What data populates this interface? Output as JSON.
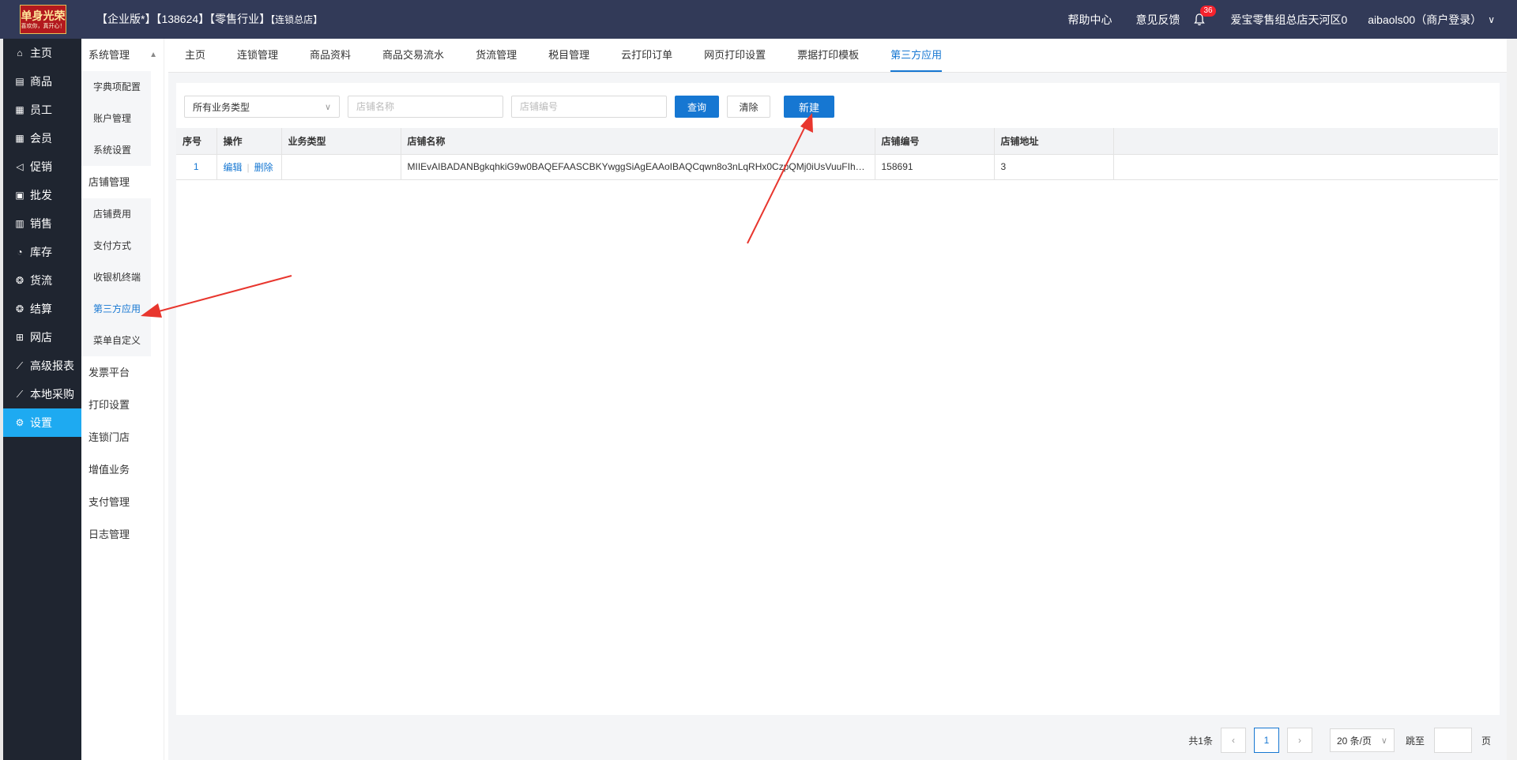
{
  "header": {
    "logo_text": "单身光荣",
    "logo_sub": "喜欢你，真开心！",
    "org_title_main": "【企业版*】【138624】【零售行业】",
    "org_title_small": "【连锁总店】",
    "help": "帮助中心",
    "feedback": "意见反馈",
    "notif_count": "36",
    "store": "爱宝零售组总店天河区0",
    "user": "aibaols00（商户登录）"
  },
  "mainnav": {
    "items": [
      {
        "label": "主页",
        "icon": "home-icon"
      },
      {
        "label": "商品",
        "icon": "goods-icon"
      },
      {
        "label": "员工",
        "icon": "staff-icon"
      },
      {
        "label": "会员",
        "icon": "member-icon"
      },
      {
        "label": "促销",
        "icon": "promo-icon"
      },
      {
        "label": "批发",
        "icon": "wholesale-icon"
      },
      {
        "label": "销售",
        "icon": "sales-icon"
      },
      {
        "label": "库存",
        "icon": "stock-icon"
      },
      {
        "label": "货流",
        "icon": "flow-icon"
      },
      {
        "label": "结算",
        "icon": "settle-icon"
      },
      {
        "label": "网店",
        "icon": "shop-icon"
      },
      {
        "label": "高级报表",
        "icon": "report-icon"
      },
      {
        "label": "本地采购",
        "icon": "purchase-icon"
      },
      {
        "label": "设置",
        "icon": "settings-icon"
      }
    ]
  },
  "subnav": {
    "g1": "系统管理",
    "g1_items": [
      "字典项配置",
      "账户管理",
      "系统设置"
    ],
    "g2": "店铺管理",
    "g2_items": [
      "店铺费用",
      "支付方式",
      "收银机终端",
      "第三方应用",
      "菜单自定义"
    ],
    "groups_after": [
      "发票平台",
      "打印设置",
      "连锁门店",
      "增值业务",
      "支付管理",
      "日志管理"
    ]
  },
  "tabs": [
    "主页",
    "连锁管理",
    "商品资料",
    "商品交易流水",
    "货流管理",
    "税目管理",
    "云打印订单",
    "网页打印设置",
    "票据打印模板",
    "第三方应用"
  ],
  "filters": {
    "biz_type": "所有业务类型",
    "store_name_placeholder": "店铺名称",
    "store_no_placeholder": "店铺编号",
    "query": "查询",
    "clear": "清除",
    "new": "新建"
  },
  "table": {
    "headers": [
      "序号",
      "操作",
      "业务类型",
      "店铺名称",
      "店铺编号",
      "店铺地址"
    ],
    "rows": [
      {
        "no": "1",
        "edit": "编辑",
        "del": "删除",
        "biz_type": "",
        "store_name": "MIIEvAIBADANBgkqhkiG9w0BAQEFAASCBKYwggSiAgEAAoIBAQCqwn8o3nLqRHx0CzpQMj0iUsVuuFIhZNvi...",
        "store_no": "158691",
        "address": "3"
      }
    ]
  },
  "pager": {
    "total": "共1条",
    "page": "1",
    "size": "20 条/页",
    "jump": "跳至",
    "page_unit": "页"
  },
  "colors": {
    "topbar": "#323a58",
    "nav": "#1f2530",
    "active": "#1eaaf1",
    "primary": "#1677d2",
    "arrow": "#e8362e"
  }
}
